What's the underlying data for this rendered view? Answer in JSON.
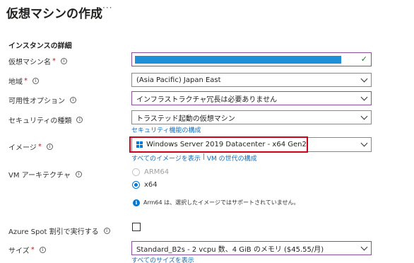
{
  "page": {
    "title": "仮想マシンの作成",
    "more_label": "···"
  },
  "instance": {
    "section_title": "インスタンスの詳細",
    "vm_name": {
      "label": "仮想マシン名",
      "required": "*",
      "info": "i",
      "value_redacted": true,
      "valid_icon": "check-icon"
    },
    "region": {
      "label": "地域",
      "required": "*",
      "info": "i",
      "value": "(Asia Pacific) Japan East"
    },
    "availability": {
      "label": "可用性オプション",
      "info": "i",
      "value": "インフラストラクチャ冗長は必要ありません"
    },
    "security": {
      "label": "セキュリティの種類",
      "info": "i",
      "value": "トラステッド起動の仮想マシン",
      "link": "セキュリティ機能の構成"
    },
    "image": {
      "label": "イメージ",
      "required": "*",
      "info": "i",
      "value": "Windows Server 2019 Datacenter - x64 Gen2",
      "icon": "windows-logo-icon",
      "link_all": "すべてのイメージを表示",
      "link_separator": "|",
      "link_gen": "VM の世代の構成",
      "highlight_color": "#d0021b"
    },
    "arch": {
      "label": "VM アーキテクチャ",
      "info": "i",
      "options": [
        {
          "label": "ARM64",
          "selected": false,
          "disabled": true
        },
        {
          "label": "x64",
          "selected": true,
          "disabled": false
        }
      ],
      "notice_icon": "i",
      "notice": "Arm64 は、選択したイメージではサポートされていません。"
    },
    "spot": {
      "label": "Azure Spot 割引で実行する",
      "info": "i",
      "checked": false
    },
    "size": {
      "label": "サイズ",
      "required": "*",
      "info": "i",
      "value": "Standard_B2s - 2 vcpu 数、4 GiB のメモリ ($45.55/月)",
      "link": "すべてのサイズを表示"
    }
  },
  "colors": {
    "accent": "#0078d4",
    "link": "#0f6cbd",
    "required": "#a4262c",
    "border_active": "#8a4f9e"
  }
}
